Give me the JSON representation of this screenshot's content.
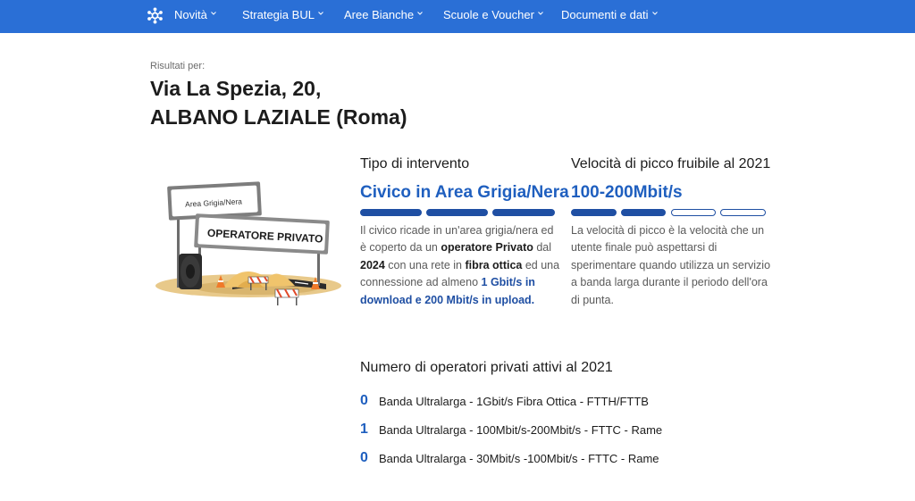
{
  "nav": {
    "items": [
      {
        "label": "Novità"
      },
      {
        "label": "Strategia BUL"
      },
      {
        "label": "Aree Bianche"
      },
      {
        "label": "Scuole e Voucher"
      },
      {
        "label": "Documenti e dati"
      }
    ]
  },
  "results": {
    "label": "Risultati per:",
    "address_line1": "Via La Spezia, 20,",
    "address_line2": "ALBANO LAZIALE (Roma)"
  },
  "illustration": {
    "sign_small": "Area Grigia/Nera",
    "sign_big": "OPERATORE PRIVATO"
  },
  "intervento": {
    "title": "Tipo di intervento",
    "value": "Civico in Area Grigia/Nera",
    "bars_filled": 3,
    "bars_total": 3,
    "text": {
      "p1": "Il civico ricade in un'area grigia/nera ed è coperto da un ",
      "b1": "operatore Privato",
      "p2": " dal ",
      "b2": "2024",
      "p3": " con una rete in ",
      "b3": "fibra ottica",
      "p4": " ed una connessione ad almeno ",
      "b4": "1 Gbit/s in download e 200 Mbit/s in upload."
    }
  },
  "velocita": {
    "title": "Velocità di picco fruibile al 2021",
    "value": "100-200Mbit/s",
    "bars_filled": 2,
    "bars_total": 4,
    "text": "La velocità di picco è la velocità che un utente finale può aspettarsi di sperimentare quando utilizza un servizio a banda larga durante il periodo dell'ora di punta."
  },
  "operatori": {
    "title": "Numero di operatori privati attivi al 2021",
    "rows": [
      {
        "count": "0",
        "label": "Banda Ultralarga - 1Gbit/s Fibra Ottica - FTTH/FTTB"
      },
      {
        "count": "1",
        "label": "Banda Ultralarga - 100Mbit/s-200Mbit/s - FTTC - Rame"
      },
      {
        "count": "0",
        "label": "Banda Ultralarga - 30Mbit/s -100Mbit/s - FTTC - Rame"
      }
    ]
  },
  "colors": {
    "nav_bg": "#2a6fd6",
    "accent": "#1f5fbf",
    "bar": "#1f4fa3"
  }
}
